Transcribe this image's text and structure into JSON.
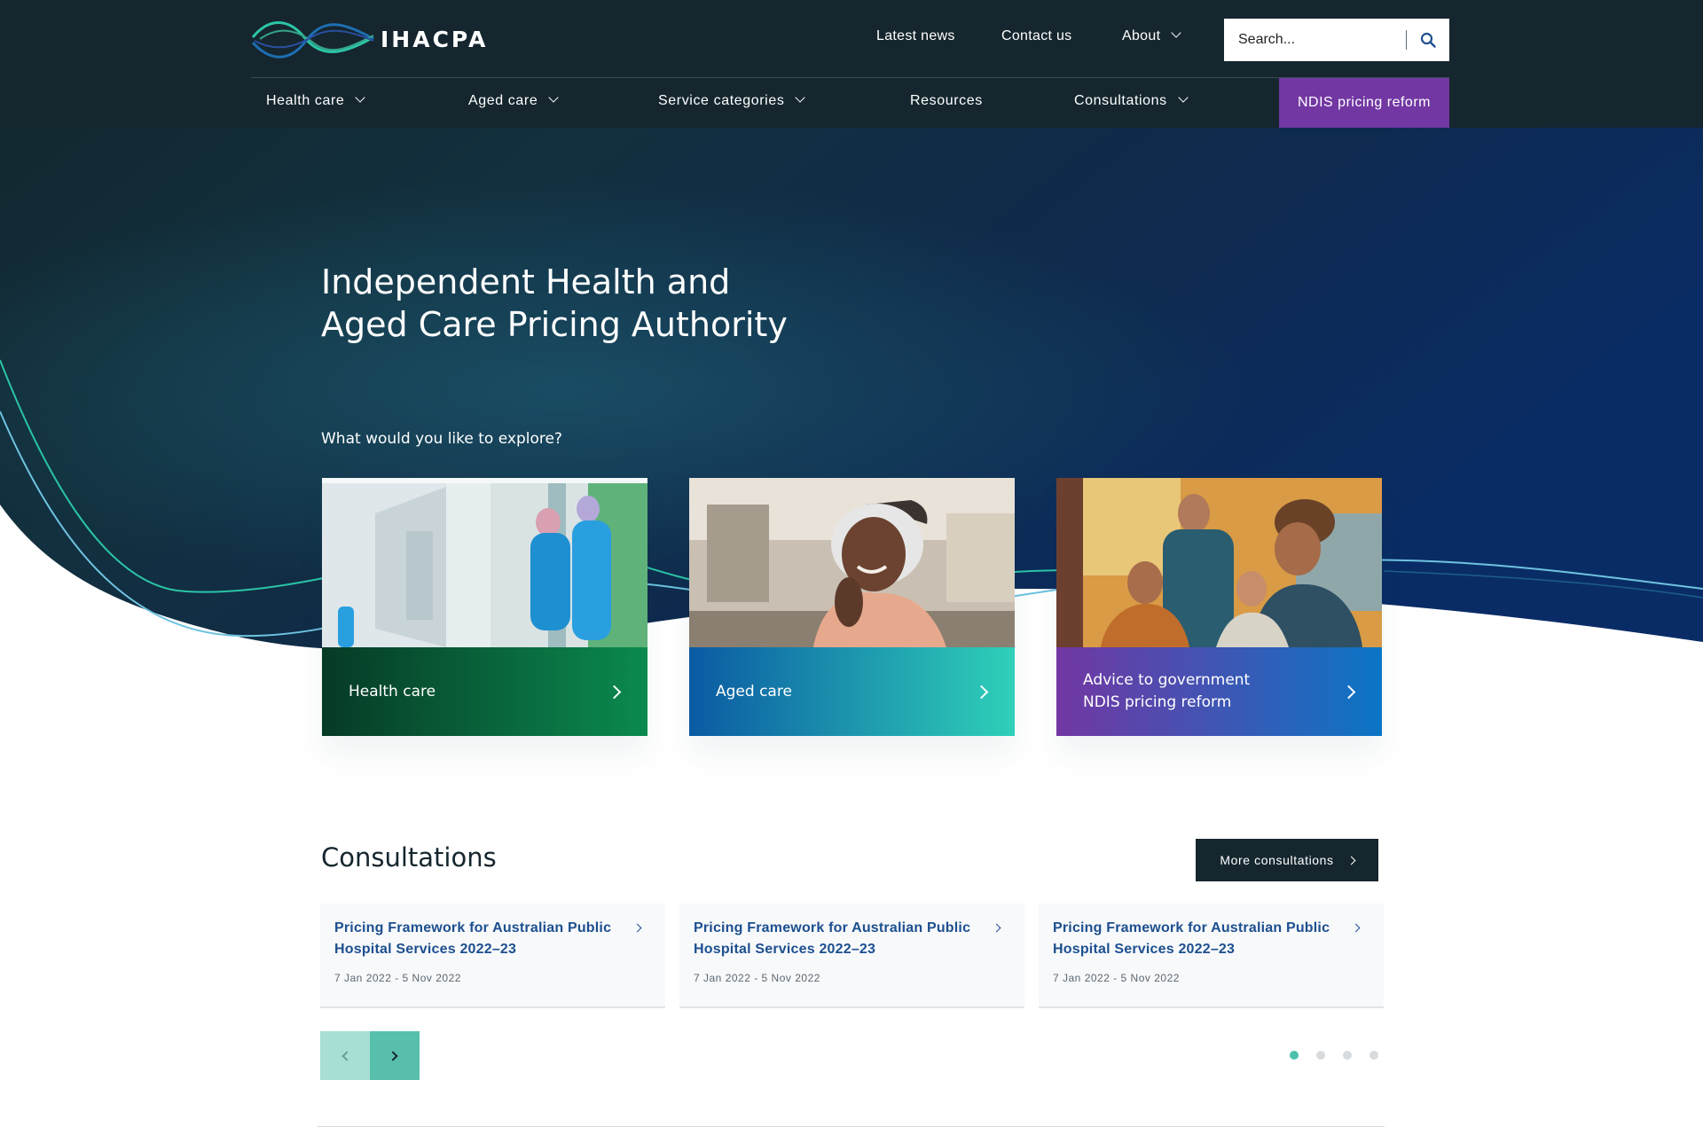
{
  "brand": {
    "name": "IHACPA"
  },
  "utility_nav": {
    "latest_news": "Latest news",
    "contact_us": "Contact us",
    "about": "About"
  },
  "search": {
    "placeholder": "Search..."
  },
  "main_nav": {
    "health_care": "Health care",
    "aged_care": "Aged care",
    "service_categories": "Service categories",
    "resources": "Resources",
    "consultations": "Consultations",
    "ndis": "NDIS pricing reform"
  },
  "hero": {
    "title_line1": "Independent Health and",
    "title_line2": "Aged Care Pricing Authority",
    "explore": "What would you like to explore?"
  },
  "feature_cards": [
    {
      "label_line1": "Health care",
      "label_line2": ""
    },
    {
      "label_line1": "Aged care",
      "label_line2": ""
    },
    {
      "label_line1": "Advice to government",
      "label_line2": "NDIS pricing reform"
    }
  ],
  "consultations": {
    "title": "Consultations",
    "more_button": "More consultations",
    "items": [
      {
        "title_line1": "Pricing Framework for Australian Public",
        "title_line2": "Hospital Services 2022–23",
        "date": "7 Jan 2022 - 5 Nov 2022"
      },
      {
        "title_line1": "Pricing Framework for Australian Public",
        "title_line2": "Hospital Services 2022–23",
        "date": "7 Jan 2022 - 5 Nov 2022"
      },
      {
        "title_line1": "Pricing Framework for Australian Public",
        "title_line2": "Hospital Services 2022–23",
        "date": "7 Jan 2022 - 5 Nov 2022"
      }
    ],
    "pagination": {
      "total": 4,
      "active": 1
    }
  },
  "colors": {
    "header_bg": "#15262e",
    "ndis_purple": "#7237a3",
    "health_green": "#0b8a4e",
    "aged_teal": "#2fd0b8",
    "link_blue": "#1d4f8f",
    "accent_teal": "#58bfad"
  },
  "icons": [
    "ihacpa-logo",
    "search-icon",
    "chevron-down-icon",
    "chevron-right-icon",
    "chevron-left-icon"
  ]
}
